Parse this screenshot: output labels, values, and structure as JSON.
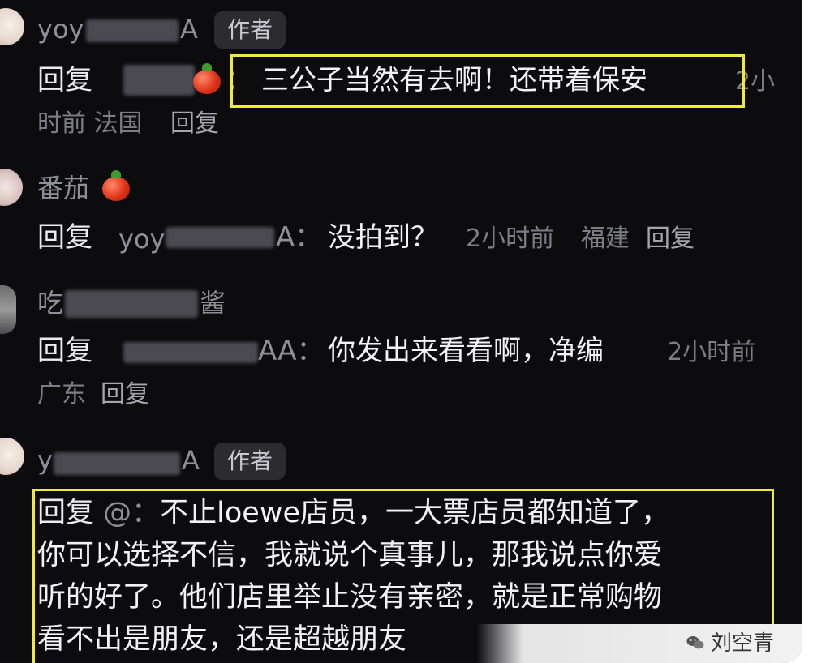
{
  "comments": [
    {
      "name_prefix": "yoy",
      "name_suffix": "A",
      "badge": "作者",
      "reply_keyword": "回复",
      "content": "三公子当然有去啊！还带着保安",
      "time_tail": "2小",
      "meta_line": "时前 法国",
      "reply_label": "回复"
    },
    {
      "name": "番茄",
      "reply_keyword": "回复",
      "reply_to_prefix": "yoy",
      "reply_to_suffix": "A：",
      "content": "没拍到？",
      "time": "2小时前",
      "location": "福建",
      "reply_label": "回复"
    },
    {
      "name_prefix": "吃",
      "name_suffix": "酱",
      "reply_keyword": "回复",
      "reply_to_suffix": "AA：",
      "content": "你发出来看看啊，净编",
      "time": "2小时前",
      "location": "广东",
      "reply_label": "回复"
    },
    {
      "name_prefix": "y",
      "name_suffix": "A",
      "badge": "作者",
      "reply_keyword": "回复",
      "reply_to": "@：",
      "content_lines": [
        "不止loewe店员，一大票店员都知道了，",
        "你可以选择不信，我就说个真事儿，那我说点你爱",
        "听的好了。他们店里举止没有亲密，就是正常购物",
        "看不出是朋友，还是超越朋友"
      ]
    }
  ],
  "watermark": {
    "icon": "wechat-icon",
    "text": "刘空青"
  },
  "colors": {
    "background": "#0c0c0f",
    "highlight": "#f1ea37",
    "muted": "#8f8f96"
  }
}
